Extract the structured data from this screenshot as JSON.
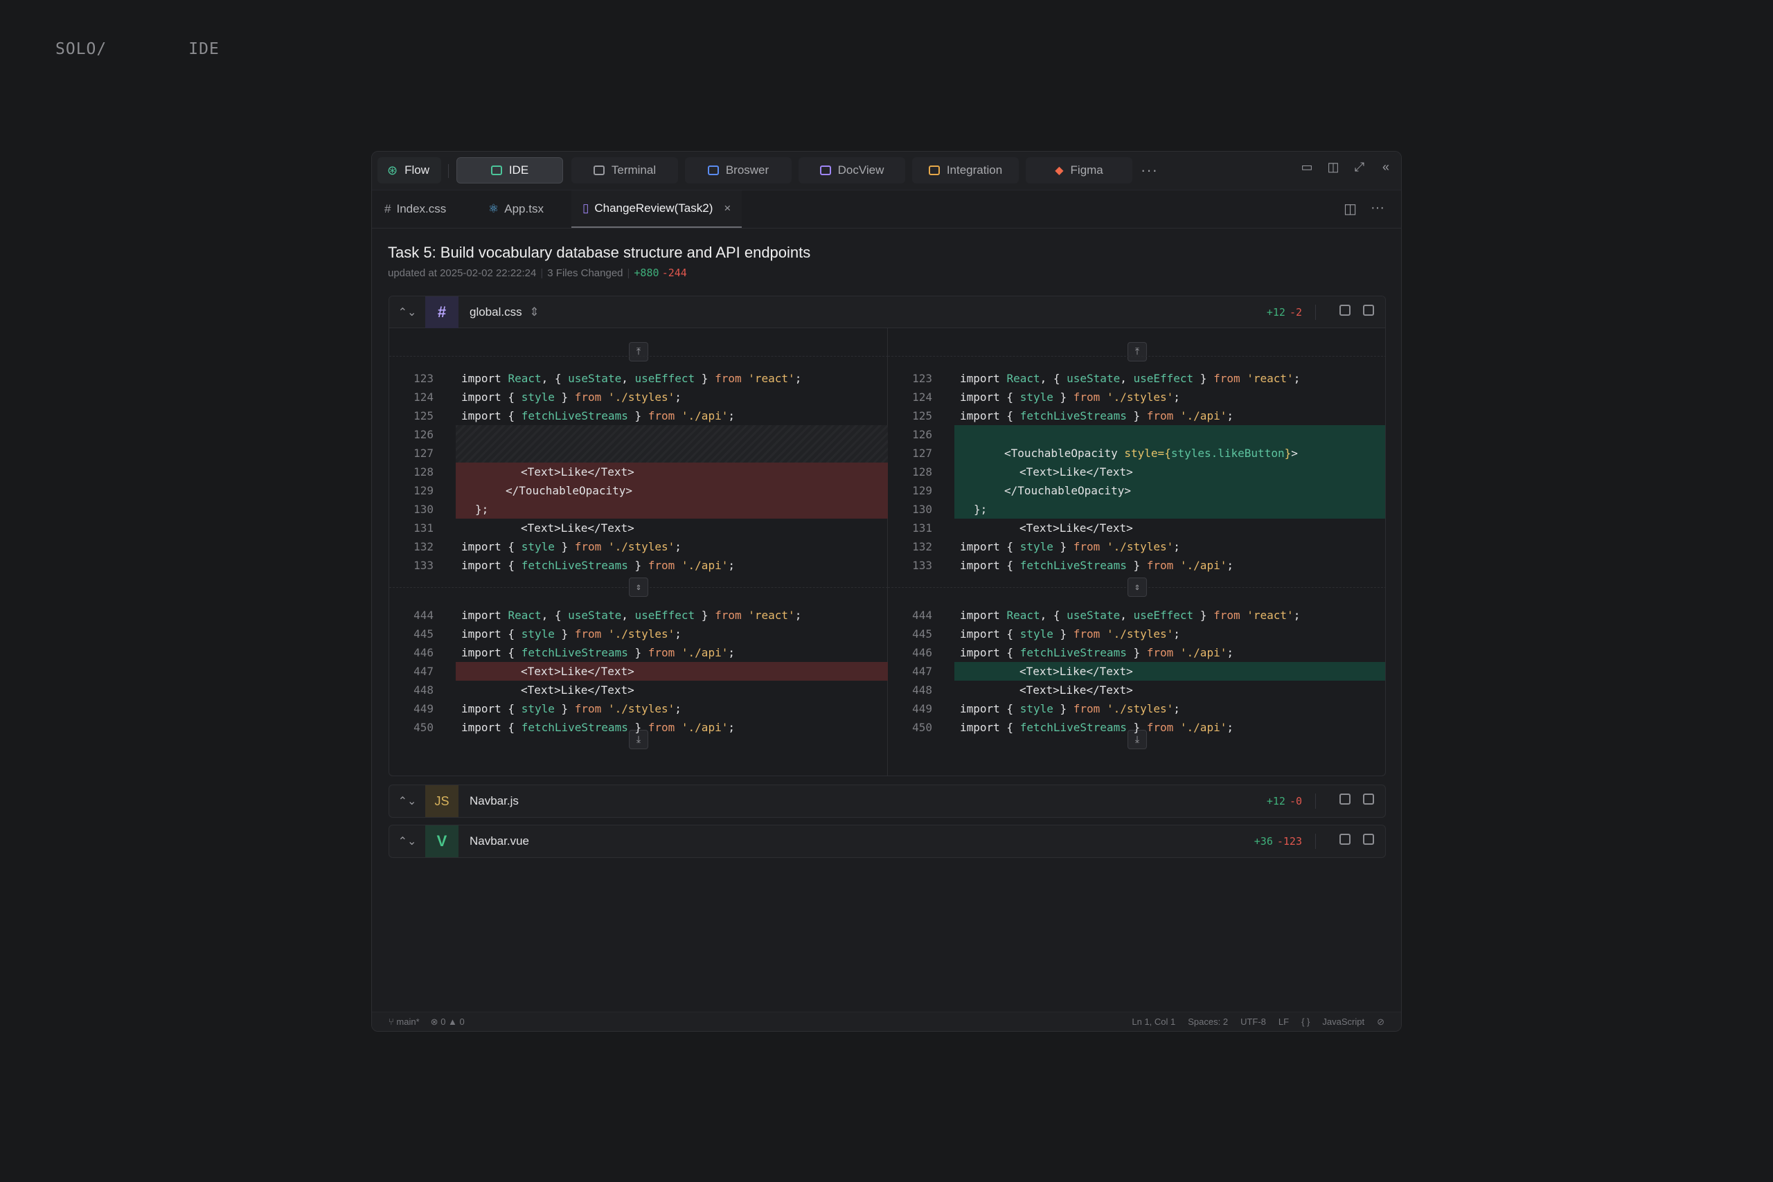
{
  "brand": {
    "left": "SOLO/",
    "right": "IDE"
  },
  "toolbar": {
    "flow": "Flow",
    "ide": "IDE",
    "terminal": "Terminal",
    "browser": "Broswer",
    "docview": "DocView",
    "integration": "Integration",
    "figma": "Figma",
    "more": "···"
  },
  "tabs": [
    {
      "label": "Index.css",
      "icon": "hash-icon"
    },
    {
      "label": "App.tsx",
      "icon": "react-icon"
    },
    {
      "label": "ChangeReview(Task2)",
      "icon": "document-icon",
      "close": "×"
    }
  ],
  "review": {
    "title": "Task 5: Build vocabulary database structure and API endpoints",
    "updated": "updated at 2025-02-02 22:22:24",
    "files_changed": "3 Files Changed",
    "added": "+880",
    "removed": "-244"
  },
  "files": [
    {
      "name": "global.css",
      "type_label": "#",
      "added": "+12",
      "removed": "-2"
    },
    {
      "name": "Navbar.js",
      "type_label": "JS",
      "added": "+12",
      "removed": "-0"
    },
    {
      "name": "Navbar.vue",
      "type_label": "V",
      "added": "+36",
      "removed": "-123"
    }
  ],
  "code": {
    "l123": "import React, { useState, useEffect } from 'react';",
    "l_style": "import { style } from './styles';",
    "l_fetch": "import { fetchLiveStreams } from './api';",
    "l_text": "<Text>Like</Text>",
    "l_close_to": "</TouchableOpacity>",
    "l_brace": "};",
    "l_open_to": "<TouchableOpacity style={styles.likeButton}>"
  },
  "status": {
    "branch": "main*",
    "errors": "0",
    "warnings": "0",
    "pos": "Ln 1, Col 1",
    "spaces": "Spaces: 2",
    "enc": "UTF-8",
    "eol": "LF",
    "braces": "{ }",
    "lang": "JavaScript"
  }
}
